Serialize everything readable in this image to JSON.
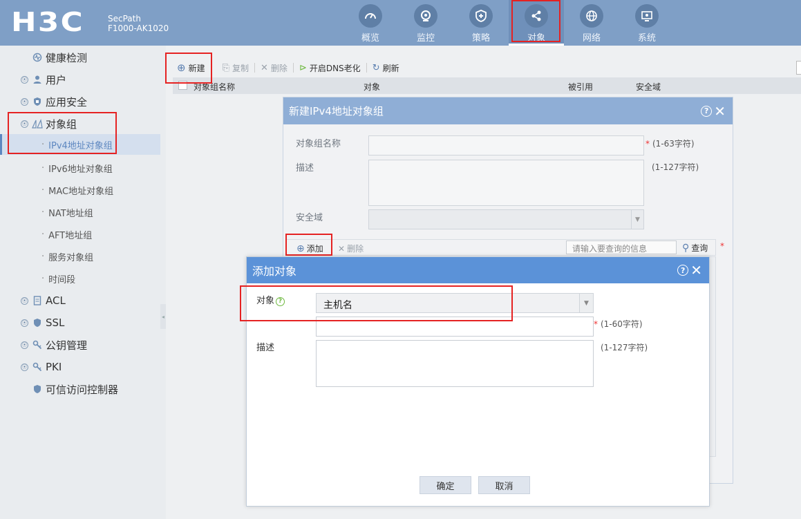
{
  "brand": {
    "logo": "H3C",
    "product_line1": "SecPath",
    "product_line2": "F1000-AK1020"
  },
  "nav": [
    {
      "label": "概览",
      "icon": "dashboard-icon"
    },
    {
      "label": "监控",
      "icon": "monitor-icon"
    },
    {
      "label": "策略",
      "icon": "shield-plus-icon"
    },
    {
      "label": "对象",
      "icon": "share-nodes-icon",
      "active": true
    },
    {
      "label": "网络",
      "icon": "globe-icon"
    },
    {
      "label": "系统",
      "icon": "system-monitor-icon"
    }
  ],
  "sidebar": {
    "items": [
      {
        "label": "健康检测",
        "icon": "health-check-icon"
      },
      {
        "label": "用户",
        "icon": "user-icon"
      },
      {
        "label": "应用安全",
        "icon": "app-security-icon"
      },
      {
        "label": "对象组",
        "icon": "object-group-icon"
      },
      {
        "label": "ACL",
        "icon": "acl-icon"
      },
      {
        "label": "SSL",
        "icon": "ssl-shield-icon"
      },
      {
        "label": "公钥管理",
        "icon": "key-icon"
      },
      {
        "label": "PKI",
        "icon": "pki-key-icon"
      },
      {
        "label": "可信访问控制器",
        "icon": "trusted-access-icon"
      }
    ],
    "sub_items": [
      "IPv4地址对象组",
      "IPv6地址对象组",
      "MAC地址对象组",
      "NAT地址组",
      "AFT地址组",
      "服务对象组",
      "时间段"
    ]
  },
  "toolbar": {
    "new_label": "新建",
    "copy_label": "复制",
    "delete_label": "删除",
    "dns_label": "开启DNS老化",
    "refresh_label": "刷新"
  },
  "table": {
    "columns": [
      "对象组名称",
      "对象",
      "被引用",
      "安全域"
    ]
  },
  "dialog_group": {
    "title": "新建IPv4地址对象组",
    "name_label": "对象组名称",
    "name_hint": "(1-63字符)",
    "desc_label": "描述",
    "desc_hint": "(1-127字符)",
    "zone_label": "安全域",
    "add_label": "添加",
    "delete_label": "删除",
    "search_placeholder": "请输入要查询的信息",
    "query_label": "查询"
  },
  "dialog_object": {
    "title": "添加对象",
    "object_label": "对象",
    "object_value": "主机名",
    "host_hint": "(1-60字符)",
    "desc_label": "描述",
    "desc_hint": "(1-127字符)",
    "ok_label": "确定",
    "cancel_label": "取消"
  },
  "colors": {
    "topbar": "#7f9fc6",
    "dialog_title": "#5b92d8",
    "highlight": "#e52222",
    "active_sub": "#5d87c0"
  }
}
